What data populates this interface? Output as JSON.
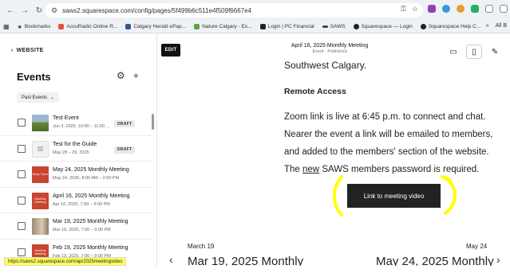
{
  "browser": {
    "url": "saws2.squarespace.com/config/pages/5f499b6c511e4f509f6667e4",
    "status_url": "https://saws2.squarespace.com/apr2025meetingvideo",
    "bookmarks": [
      {
        "label": "Bookmarks",
        "color": "#666666"
      },
      {
        "label": "AccuRadio Online R...",
        "color": "#e84c3d"
      },
      {
        "label": "Calgary Herald ePap...",
        "color": "#2b5797"
      },
      {
        "label": "Nature Calgary - Ex...",
        "color": "#5aa447"
      },
      {
        "label": "Login | PC Financial",
        "color": "#222222"
      },
      {
        "label": "SAWS",
        "color": "#444444"
      },
      {
        "label": "Squarespace — Login",
        "color": "#222222"
      },
      {
        "label": "Squarespace Help C...",
        "color": "#222222"
      }
    ],
    "bookmarks_more": "»",
    "all_bookmarks": "All B"
  },
  "sidebar": {
    "back_label": "WEBSITE",
    "title": "Events",
    "filter_label": "Past Events",
    "events": [
      {
        "title": "Test Event",
        "meta": "Jun 3, 2025, 10:00 – 11:00 ...",
        "badge": "DRAFT",
        "thumb": "photo"
      },
      {
        "title": "Test for the Guide",
        "meta": "May 28 – 29, 2025",
        "badge": "DRAFT",
        "thumb": "placeholder"
      },
      {
        "title": "May 24, 2025 Monthly Meeting",
        "meta": "May 24, 2025, 8:00 AM – 2:00 PM",
        "badge": "",
        "thumb": "red",
        "thumb_text": "Shop Tours"
      },
      {
        "title": "April 16, 2025 Monthly Meeting",
        "meta": "Apr 16, 2025, 7:00 – 9:00 PM",
        "badge": "",
        "thumb": "red",
        "thumb_text": "Monthly Meeting"
      },
      {
        "title": "Mar 19, 2025 Monthly Meeting",
        "meta": "Mar 19, 2025, 7:00 – 9:00 PM",
        "badge": "",
        "thumb": "photo2"
      },
      {
        "title": "Feb 19, 2025 Monthly Meeting",
        "meta": "Feb 19, 2025, 7:00 – 9:00 PM",
        "badge": "",
        "thumb": "red",
        "thumb_text": "Monthly Meeting"
      }
    ]
  },
  "editor": {
    "edit_label": "EDIT",
    "page_title": "April 16, 2025 Monthly Meeting",
    "page_status": "Event · Published"
  },
  "content": {
    "location": "Southwest Calgary.",
    "heading": "Remote Access",
    "lines": [
      "Zoom link is live at 6:45 p.m. to connect and chat.",
      "Nearer the event a link will be emailed to members,",
      "and added to the members' section of the website."
    ],
    "last_pre": "The ",
    "last_underlined": "new",
    "last_post": " SAWS members password is required.",
    "button_label": "Link to meeting video"
  },
  "pagination": {
    "prev_date": "March 19",
    "prev_title": "Mar 19, 2025 Monthly",
    "next_date": "May 24",
    "next_title": "May 24, 2025 Monthly"
  },
  "colors": {
    "highlight": "#ffff00",
    "thumb_red": "#c8452f",
    "button_bg": "#222222"
  }
}
